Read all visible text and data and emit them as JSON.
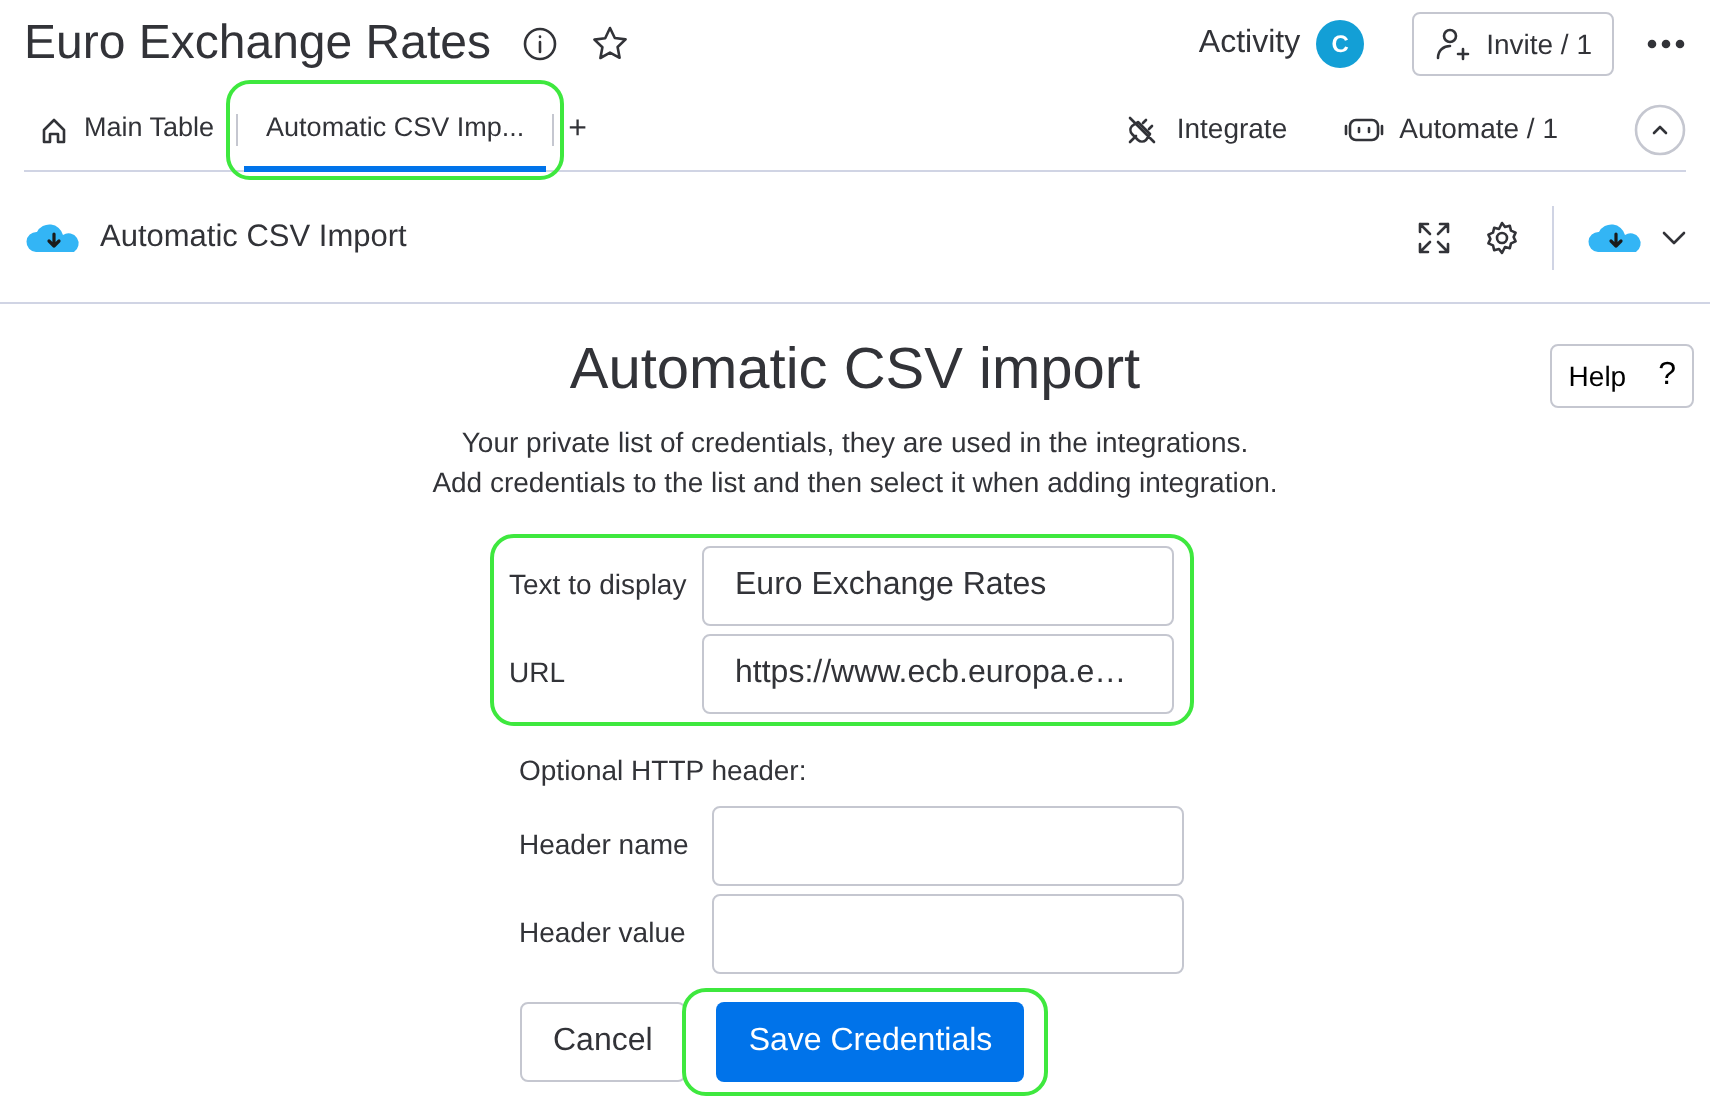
{
  "board": {
    "title": "Euro Exchange Rates",
    "activity": "Activity",
    "avatar": "C",
    "invite": "Invite / 1"
  },
  "tabs": [
    {
      "label": "Main Table",
      "kind": "home",
      "selected": false,
      "highlight": false
    },
    {
      "label": "Automatic CSV Imp...",
      "kind": "plain",
      "selected": true,
      "highlight": true
    }
  ],
  "add_tab": "+",
  "tools": [
    {
      "label": "Integrate",
      "kind": "plug"
    },
    {
      "label": "Automate / 1",
      "kind": "robot"
    }
  ],
  "view": {
    "title": "Automatic CSV Import"
  },
  "help": {
    "label": "Help",
    "icon": "?"
  },
  "form": {
    "heading": "Automatic CSV import",
    "intro": [
      "Your private list of credentials, they are used in the integrations.",
      "Add credentials to the list and then select it when adding integration."
    ],
    "main_fields": [
      {
        "label": "Text to display",
        "value": "Euro Exchange Rates"
      },
      {
        "label": "URL",
        "value": "https://www.ecb.europa.e…"
      }
    ],
    "main_highlight": true,
    "optional_title": "Optional HTTP header:",
    "optional_fields": [
      {
        "label": "Header name"
      },
      {
        "label": "Header value"
      }
    ],
    "buttons": [
      {
        "label": "Cancel",
        "kind": "secondary",
        "highlight": false
      },
      {
        "label": "Save Credentials",
        "kind": "primary",
        "highlight": true
      }
    ]
  }
}
